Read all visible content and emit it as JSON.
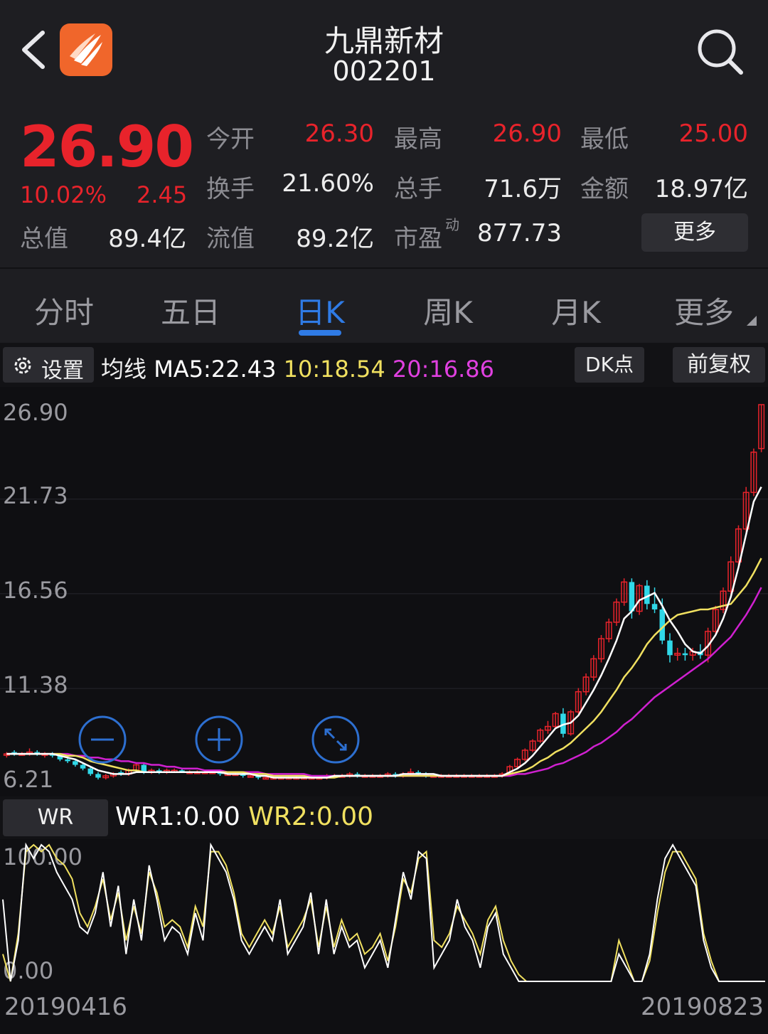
{
  "header": {
    "title": "九鼎新材",
    "code": "002201"
  },
  "quote": {
    "price": "26.90",
    "change_pct": "10.02%",
    "change": "2.45",
    "rows": [
      [
        {
          "label": "今开",
          "value": "26.30",
          "red": true
        },
        {
          "label": "最高",
          "value": "26.90",
          "red": true
        },
        {
          "label": "最低",
          "value": "25.00",
          "red": true
        }
      ],
      [
        {
          "label": "换手",
          "value": "21.60%",
          "red": false
        },
        {
          "label": "总手",
          "value": "71.6万",
          "red": false
        },
        {
          "label": "金额",
          "value": "18.97亿",
          "red": false
        }
      ]
    ],
    "total_cap_label": "总值",
    "total_cap": "89.4亿",
    "float_cap_label": "流值",
    "float_cap": "89.2亿",
    "pe_label": "市盈",
    "pe_sup": "动",
    "pe": "877.73",
    "more_label": "更多"
  },
  "tabs": [
    "分时",
    "五日",
    "日K",
    "周K",
    "月K",
    "更多"
  ],
  "active_tab": 2,
  "toolbar": {
    "settings_label": "设置",
    "ma_prefix": "均线",
    "ma5": "MA5:22.43",
    "ma10": "10:18.54",
    "ma20": "20:16.86",
    "dk_label": "DK点",
    "adjust_label": "前复权"
  },
  "wr": {
    "button": "WR",
    "wr1": "WR1:0.00",
    "wr2": "WR2:0.00"
  },
  "dates": {
    "start": "20190416",
    "end": "20190823"
  },
  "colors": {
    "up": "#e8232b",
    "down": "#30d8e8",
    "ma5": "#ffffff",
    "ma10": "#f0e060",
    "ma20": "#d020d0",
    "accent": "#2f7be6",
    "wr1": "#ffffff",
    "wr2": "#f0e060"
  },
  "icons": [
    "back-icon",
    "app-logo",
    "search-icon",
    "gear-icon",
    "zoom-out-icon",
    "zoom-in-icon",
    "fullscreen-icon"
  ],
  "chart_data": [
    {
      "type": "candlestick",
      "title": "",
      "ylim": [
        6.21,
        26.9
      ],
      "y_ticks": [
        "26.90",
        "21.73",
        "16.56",
        "11.38",
        "6.21"
      ],
      "x_range": [
        "20190416",
        "20190823"
      ],
      "candles": [
        [
          7.8,
          7.9,
          7.6,
          7.8
        ],
        [
          7.9,
          8.0,
          7.7,
          7.8
        ],
        [
          7.8,
          7.9,
          7.7,
          7.8
        ],
        [
          7.8,
          8.1,
          7.7,
          7.9
        ],
        [
          7.9,
          8.0,
          7.7,
          7.8
        ],
        [
          7.8,
          7.9,
          7.6,
          7.8
        ],
        [
          7.8,
          7.9,
          7.6,
          7.7
        ],
        [
          7.7,
          7.8,
          7.4,
          7.5
        ],
        [
          7.5,
          7.6,
          7.3,
          7.4
        ],
        [
          7.4,
          7.5,
          7.1,
          7.2
        ],
        [
          7.2,
          7.3,
          6.9,
          7.0
        ],
        [
          7.0,
          7.1,
          6.6,
          6.7
        ],
        [
          6.7,
          6.8,
          6.4,
          6.5
        ],
        [
          6.5,
          6.7,
          6.4,
          6.6
        ],
        [
          6.6,
          6.8,
          6.5,
          6.7
        ],
        [
          6.8,
          6.9,
          6.6,
          6.7
        ],
        [
          6.7,
          7.0,
          6.6,
          6.9
        ],
        [
          6.9,
          7.3,
          6.8,
          7.2
        ],
        [
          7.2,
          7.3,
          6.7,
          6.8
        ],
        [
          6.8,
          7.0,
          6.7,
          6.9
        ],
        [
          6.9,
          7.0,
          6.7,
          6.8
        ],
        [
          6.8,
          7.0,
          6.7,
          6.9
        ],
        [
          6.9,
          7.0,
          6.8,
          6.9
        ],
        [
          6.9,
          7.0,
          6.8,
          6.8
        ],
        [
          6.8,
          6.9,
          6.7,
          6.8
        ],
        [
          6.8,
          6.9,
          6.7,
          6.8
        ],
        [
          6.8,
          6.9,
          6.7,
          6.8
        ],
        [
          6.8,
          6.9,
          6.7,
          6.8
        ],
        [
          6.8,
          6.9,
          6.6,
          6.7
        ],
        [
          6.7,
          6.8,
          6.6,
          6.7
        ],
        [
          6.7,
          6.8,
          6.6,
          6.7
        ],
        [
          6.7,
          6.8,
          6.5,
          6.6
        ],
        [
          6.6,
          6.7,
          6.5,
          6.6
        ],
        [
          6.6,
          6.7,
          6.4,
          6.5
        ],
        [
          6.5,
          6.6,
          6.4,
          6.5
        ],
        [
          6.5,
          6.6,
          6.4,
          6.5
        ],
        [
          6.5,
          6.6,
          6.4,
          6.5
        ],
        [
          6.5,
          6.6,
          6.4,
          6.5
        ],
        [
          6.5,
          6.6,
          6.4,
          6.5
        ],
        [
          6.5,
          6.6,
          6.4,
          6.5
        ],
        [
          6.5,
          6.6,
          6.4,
          6.5
        ],
        [
          6.5,
          6.6,
          6.4,
          6.5
        ],
        [
          6.5,
          6.7,
          6.4,
          6.6
        ],
        [
          6.6,
          6.7,
          6.5,
          6.6
        ],
        [
          6.6,
          6.7,
          6.5,
          6.6
        ],
        [
          6.6,
          6.8,
          6.5,
          6.7
        ],
        [
          6.7,
          6.8,
          6.5,
          6.6
        ],
        [
          6.6,
          6.7,
          6.5,
          6.6
        ],
        [
          6.6,
          6.7,
          6.5,
          6.6
        ],
        [
          6.6,
          6.7,
          6.5,
          6.6
        ],
        [
          6.6,
          6.8,
          6.5,
          6.7
        ],
        [
          6.7,
          6.8,
          6.5,
          6.6
        ],
        [
          6.6,
          6.8,
          6.5,
          6.7
        ],
        [
          6.7,
          7.0,
          6.6,
          6.8
        ],
        [
          6.8,
          6.9,
          6.6,
          6.7
        ],
        [
          6.7,
          6.8,
          6.5,
          6.6
        ],
        [
          6.6,
          6.7,
          6.5,
          6.6
        ],
        [
          6.6,
          6.7,
          6.5,
          6.6
        ],
        [
          6.6,
          6.7,
          6.5,
          6.6
        ],
        [
          6.6,
          6.7,
          6.5,
          6.6
        ],
        [
          6.6,
          6.7,
          6.5,
          6.6
        ],
        [
          6.6,
          6.7,
          6.5,
          6.6
        ],
        [
          6.6,
          6.7,
          6.5,
          6.6
        ],
        [
          6.6,
          6.7,
          6.5,
          6.6
        ],
        [
          6.6,
          6.7,
          6.5,
          6.6
        ],
        [
          6.6,
          6.8,
          6.5,
          6.7
        ],
        [
          6.7,
          7.2,
          6.6,
          7.1
        ],
        [
          7.1,
          7.6,
          7.0,
          7.5
        ],
        [
          7.5,
          8.1,
          7.4,
          8.0
        ],
        [
          8.0,
          8.6,
          7.9,
          8.5
        ],
        [
          8.5,
          9.2,
          8.4,
          9.1
        ],
        [
          9.1,
          9.6,
          8.9,
          9.3
        ],
        [
          9.3,
          10.1,
          9.2,
          10.0
        ],
        [
          10.0,
          10.3,
          8.7,
          8.9
        ],
        [
          8.9,
          10.2,
          8.8,
          10.1
        ],
        [
          10.1,
          11.4,
          10.0,
          11.2
        ],
        [
          11.2,
          12.2,
          11.0,
          12.0
        ],
        [
          12.0,
          13.2,
          11.8,
          13.0
        ],
        [
          13.0,
          14.3,
          12.8,
          14.1
        ],
        [
          14.1,
          15.2,
          13.9,
          15.0
        ],
        [
          15.0,
          16.3,
          14.8,
          16.1
        ],
        [
          16.1,
          17.4,
          15.9,
          17.2
        ],
        [
          17.2,
          17.4,
          15.2,
          15.6
        ],
        [
          15.6,
          17.1,
          15.4,
          17.0
        ],
        [
          17.0,
          17.3,
          15.7,
          16.0
        ],
        [
          16.0,
          16.9,
          15.5,
          15.7
        ],
        [
          15.7,
          16.3,
          13.8,
          14.0
        ],
        [
          14.0,
          14.4,
          12.8,
          13.2
        ],
        [
          13.2,
          13.6,
          12.9,
          13.3
        ],
        [
          13.3,
          13.6,
          12.9,
          13.2
        ],
        [
          13.2,
          13.6,
          12.9,
          13.4
        ],
        [
          13.4,
          13.8,
          13.0,
          13.2
        ],
        [
          13.2,
          14.7,
          12.8,
          14.5
        ],
        [
          14.5,
          15.9,
          14.3,
          15.7
        ],
        [
          15.7,
          16.9,
          15.5,
          16.7
        ],
        [
          16.7,
          18.6,
          16.5,
          18.3
        ],
        [
          18.3,
          20.3,
          18.1,
          20.1
        ],
        [
          20.1,
          22.4,
          19.9,
          22.1
        ],
        [
          22.1,
          24.5,
          21.9,
          24.3
        ],
        [
          24.5,
          26.9,
          24.3,
          26.9
        ]
      ],
      "ma5": [
        7.8,
        7.8,
        7.8,
        7.8,
        7.8,
        7.8,
        7.8,
        7.7,
        7.6,
        7.5,
        7.3,
        7.1,
        6.9,
        6.8,
        6.7,
        6.7,
        6.7,
        6.8,
        6.8,
        6.8,
        6.8,
        6.8,
        6.8,
        6.8,
        6.8,
        6.8,
        6.8,
        6.8,
        6.8,
        6.7,
        6.7,
        6.7,
        6.7,
        6.6,
        6.6,
        6.5,
        6.5,
        6.5,
        6.5,
        6.5,
        6.5,
        6.5,
        6.5,
        6.6,
        6.6,
        6.6,
        6.6,
        6.6,
        6.6,
        6.6,
        6.6,
        6.6,
        6.7,
        6.7,
        6.7,
        6.7,
        6.7,
        6.6,
        6.6,
        6.6,
        6.6,
        6.6,
        6.6,
        6.6,
        6.6,
        6.6,
        6.8,
        7.0,
        7.3,
        7.7,
        8.2,
        8.7,
        9.2,
        9.4,
        9.5,
        9.9,
        10.6,
        11.3,
        12.1,
        13.0,
        14.0,
        15.2,
        15.6,
        16.2,
        16.4,
        16.6,
        15.9,
        15.1,
        14.5,
        13.8,
        13.4,
        13.3,
        13.7,
        14.3,
        15.2,
        16.4,
        18.0,
        19.8,
        21.6,
        22.4
      ],
      "ma10": [
        7.8,
        7.8,
        7.8,
        7.8,
        7.8,
        7.8,
        7.8,
        7.8,
        7.7,
        7.7,
        7.6,
        7.4,
        7.3,
        7.2,
        7.1,
        7.0,
        6.9,
        6.9,
        6.8,
        6.8,
        6.8,
        6.8,
        6.8,
        6.8,
        6.8,
        6.8,
        6.8,
        6.8,
        6.8,
        6.8,
        6.8,
        6.8,
        6.7,
        6.7,
        6.7,
        6.6,
        6.6,
        6.6,
        6.6,
        6.6,
        6.5,
        6.5,
        6.5,
        6.5,
        6.6,
        6.6,
        6.6,
        6.6,
        6.6,
        6.6,
        6.6,
        6.6,
        6.6,
        6.6,
        6.6,
        6.6,
        6.6,
        6.6,
        6.6,
        6.6,
        6.6,
        6.6,
        6.6,
        6.6,
        6.6,
        6.6,
        6.7,
        6.8,
        6.9,
        7.1,
        7.4,
        7.6,
        7.9,
        8.1,
        8.4,
        8.8,
        9.2,
        9.6,
        10.1,
        10.7,
        11.3,
        12.0,
        12.5,
        13.1,
        13.8,
        14.3,
        14.7,
        15.1,
        15.4,
        15.5,
        15.6,
        15.7,
        15.7,
        15.8,
        15.9,
        16.0,
        16.5,
        17.0,
        17.7,
        18.5
      ],
      "ma20": [
        7.8,
        7.8,
        7.8,
        7.8,
        7.8,
        7.8,
        7.8,
        7.8,
        7.8,
        7.7,
        7.7,
        7.6,
        7.6,
        7.5,
        7.5,
        7.4,
        7.4,
        7.3,
        7.3,
        7.2,
        7.2,
        7.1,
        7.1,
        7.0,
        7.0,
        7.0,
        6.9,
        6.9,
        6.9,
        6.8,
        6.8,
        6.8,
        6.8,
        6.8,
        6.7,
        6.7,
        6.7,
        6.7,
        6.7,
        6.7,
        6.6,
        6.6,
        6.6,
        6.6,
        6.6,
        6.6,
        6.6,
        6.6,
        6.6,
        6.6,
        6.6,
        6.6,
        6.6,
        6.6,
        6.6,
        6.6,
        6.6,
        6.6,
        6.6,
        6.6,
        6.6,
        6.6,
        6.6,
        6.6,
        6.6,
        6.6,
        6.6,
        6.7,
        6.7,
        6.8,
        6.9,
        7.0,
        7.2,
        7.3,
        7.5,
        7.7,
        7.9,
        8.2,
        8.4,
        8.7,
        9.0,
        9.4,
        9.7,
        10.1,
        10.5,
        10.9,
        11.2,
        11.5,
        11.8,
        12.1,
        12.4,
        12.7,
        13.0,
        13.4,
        13.8,
        14.2,
        14.8,
        15.4,
        16.1,
        16.9
      ]
    },
    {
      "type": "line",
      "title": "WR",
      "ylim": [
        0,
        100
      ],
      "y_ticks": [
        "100.00",
        "0.00"
      ],
      "series": [
        {
          "name": "WR1",
          "values": [
            60,
            0,
            30,
            100,
            90,
            100,
            95,
            80,
            70,
            60,
            40,
            35,
            50,
            80,
            40,
            70,
            20,
            60,
            30,
            85,
            60,
            30,
            40,
            35,
            20,
            50,
            30,
            100,
            90,
            80,
            60,
            30,
            20,
            30,
            40,
            30,
            60,
            20,
            30,
            40,
            65,
            20,
            60,
            20,
            40,
            25,
            30,
            10,
            20,
            30,
            10,
            45,
            80,
            60,
            95,
            90,
            10,
            20,
            30,
            60,
            40,
            30,
            10,
            40,
            50,
            20,
            10,
            0,
            0,
            0,
            0,
            0,
            0,
            0,
            0,
            0,
            0,
            0,
            0,
            0,
            20,
            10,
            0,
            0,
            20,
            60,
            90,
            100,
            90,
            80,
            70,
            30,
            10,
            0,
            0,
            0,
            0,
            0,
            0,
            0
          ]
        },
        {
          "name": "WR2",
          "values": [
            20,
            0,
            35,
            95,
            100,
            95,
            100,
            90,
            85,
            75,
            50,
            40,
            55,
            75,
            45,
            65,
            30,
            55,
            35,
            80,
            65,
            40,
            45,
            40,
            25,
            55,
            40,
            95,
            95,
            85,
            65,
            35,
            25,
            35,
            45,
            35,
            55,
            25,
            35,
            45,
            60,
            25,
            55,
            25,
            45,
            30,
            35,
            20,
            25,
            35,
            15,
            40,
            75,
            65,
            90,
            95,
            30,
            25,
            35,
            55,
            45,
            35,
            20,
            45,
            55,
            30,
            15,
            5,
            0,
            0,
            0,
            0,
            0,
            0,
            0,
            0,
            0,
            0,
            0,
            0,
            30,
            15,
            0,
            0,
            15,
            50,
            80,
            95,
            95,
            85,
            75,
            35,
            15,
            0,
            0,
            0,
            0,
            0,
            0,
            0
          ]
        }
      ]
    }
  ]
}
